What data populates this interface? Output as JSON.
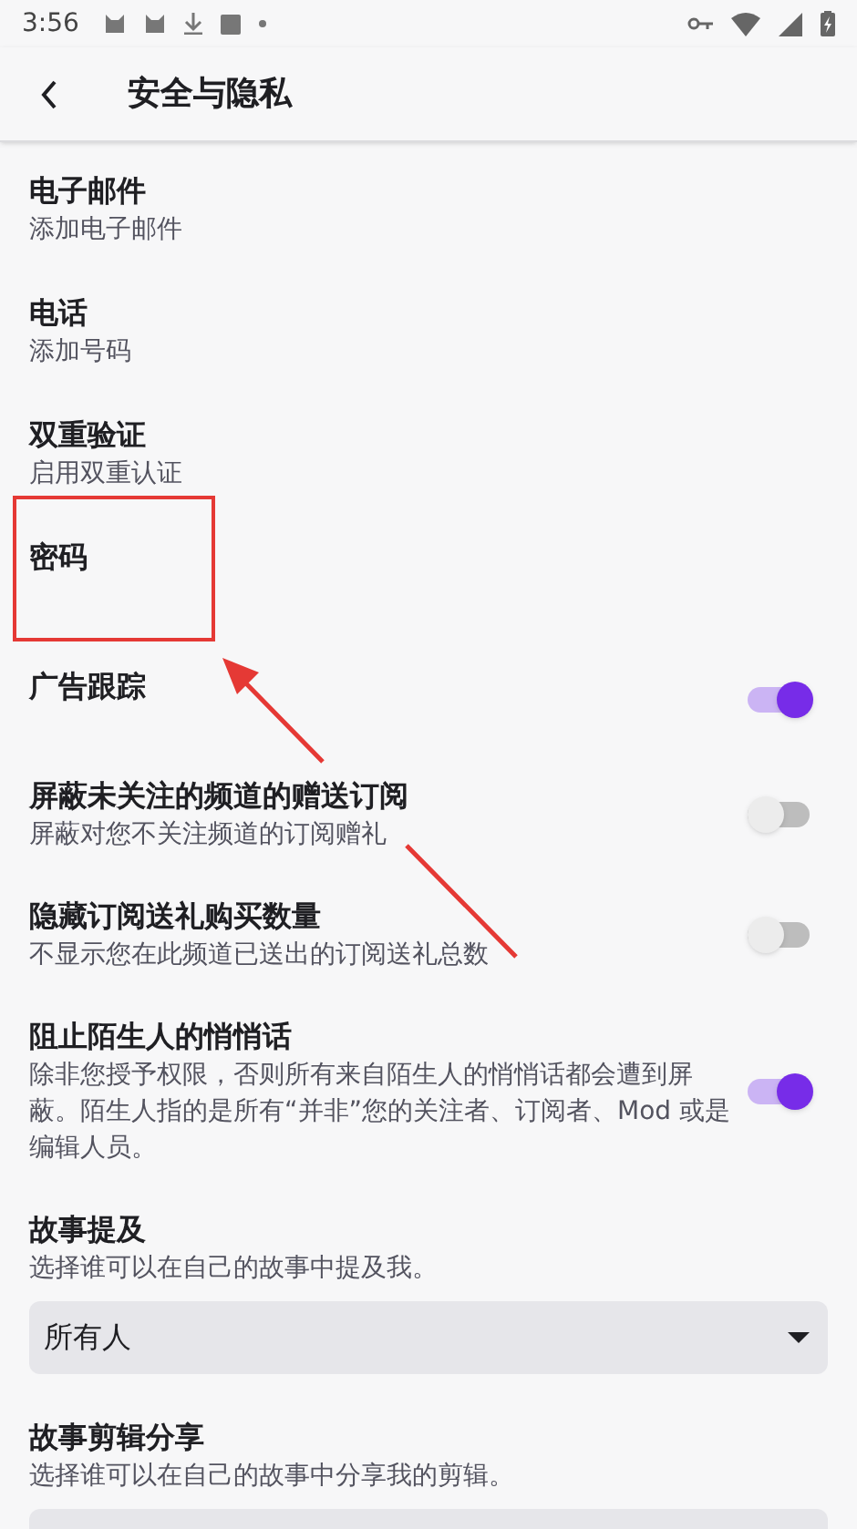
{
  "status_bar": {
    "time": "3:56"
  },
  "header": {
    "title": "安全与隐私"
  },
  "items": [
    {
      "kind": "text",
      "title": "电子邮件",
      "subtitle": "添加电子邮件"
    },
    {
      "kind": "text",
      "title": "电话",
      "subtitle": "添加号码"
    },
    {
      "kind": "text",
      "title": "双重验证",
      "subtitle": "启用双重认证"
    },
    {
      "kind": "text",
      "title": "密码"
    },
    {
      "kind": "toggle",
      "title": "广告跟踪",
      "on": true
    },
    {
      "kind": "toggle",
      "title": "屏蔽未关注的频道的赠送订阅",
      "subtitle": "屏蔽对您不关注频道的订阅赠礼",
      "on": false
    },
    {
      "kind": "toggle",
      "title": "隐藏订阅送礼购买数量",
      "subtitle": "不显示您在此频道已送出的订阅送礼总数",
      "on": false
    },
    {
      "kind": "toggle",
      "title": "阻止陌生人的悄悄话",
      "subtitle": "除非您授予权限，否则所有来自陌生人的悄悄话都会遭到屏蔽。陌生人指的是所有“并非”您的关注者、订阅者、Mod 或是编辑人员。",
      "on": true
    },
    {
      "kind": "select",
      "title": "故事提及",
      "subtitle": "选择谁可以在自己的故事中提及我。",
      "value": "所有人"
    },
    {
      "kind": "select",
      "title": "故事剪辑分享",
      "subtitle": "选择谁可以在自己的故事中分享我的剪辑。"
    }
  ],
  "annotations": [
    {
      "kind": "box",
      "color": "#e53935"
    },
    {
      "kind": "arrow",
      "color": "#e53935"
    }
  ]
}
